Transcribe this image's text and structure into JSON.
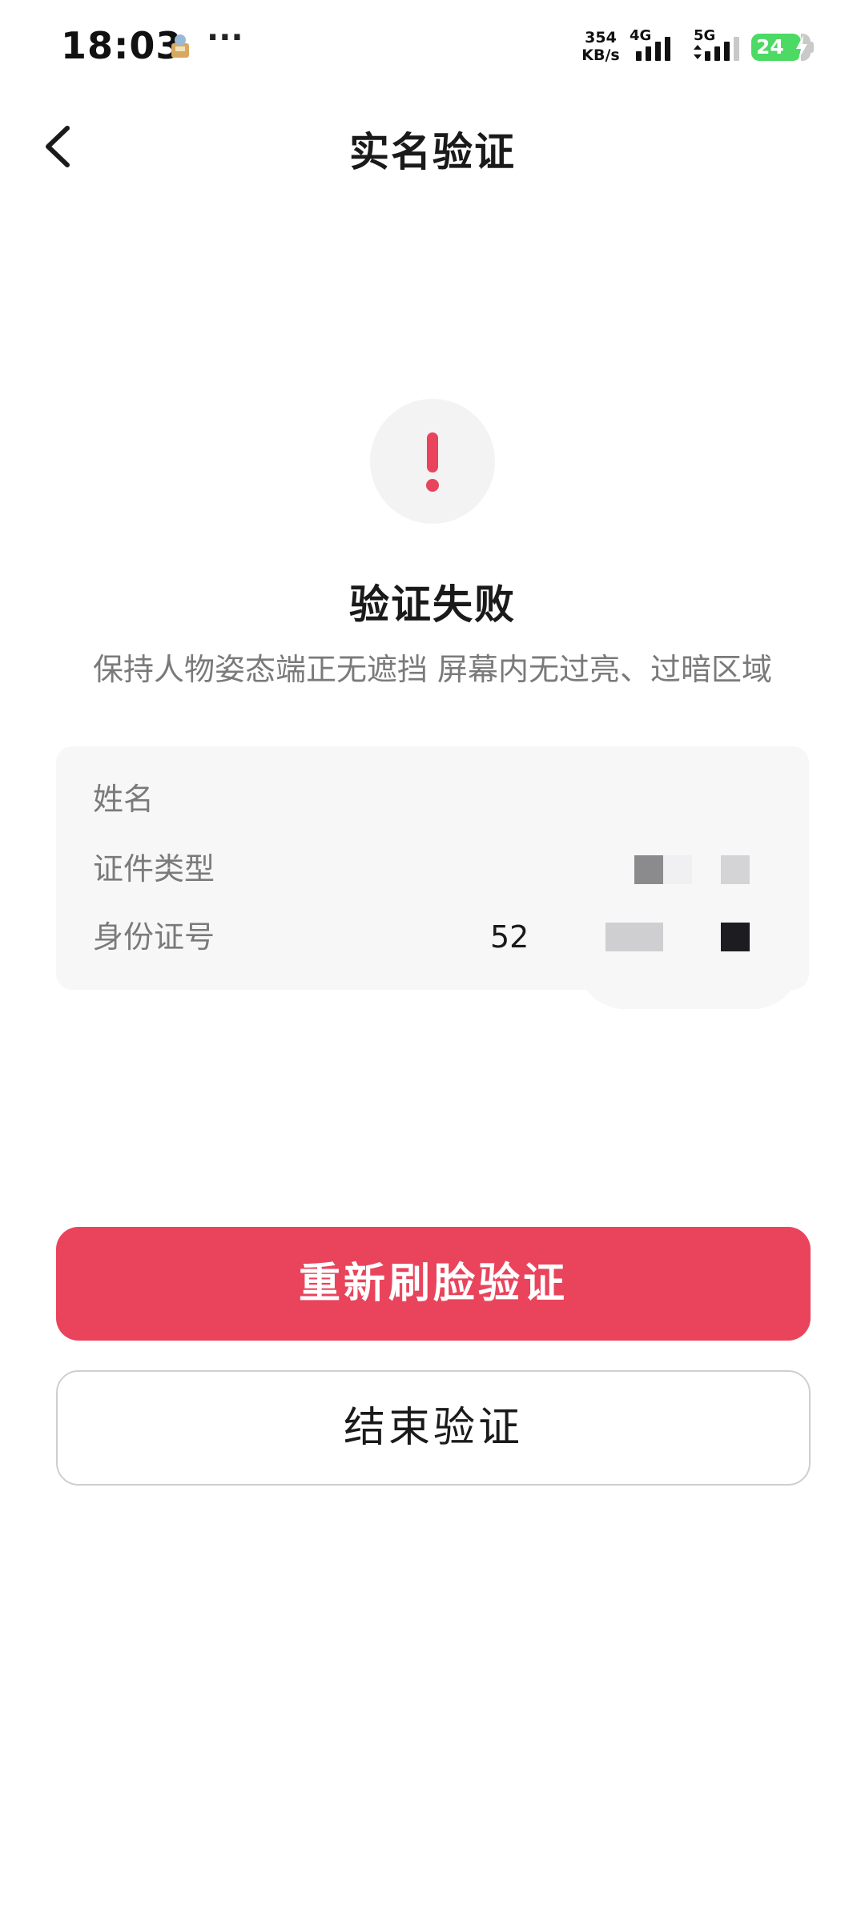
{
  "status_bar": {
    "time": "18:03",
    "more": "···",
    "speed_value": "354",
    "speed_unit": "KB/s",
    "net1_label": "4G",
    "net2_label": "5G",
    "battery_level": "24"
  },
  "nav": {
    "title": "实名验证"
  },
  "result": {
    "icon_glyph": "!",
    "title": "验证失败",
    "tip": "保持人物姿态端正无遮挡 屏幕内无过亮、过暗区域"
  },
  "info": {
    "name_label": "姓名",
    "id_type_label": "证件类型",
    "id_number_label": "身份证号",
    "id_number_value": "52"
  },
  "actions": {
    "retry_label": "重新刷脸验证",
    "end_label": "结束验证"
  },
  "colors": {
    "accent": "#e9445c",
    "battery": "#4cd964"
  }
}
